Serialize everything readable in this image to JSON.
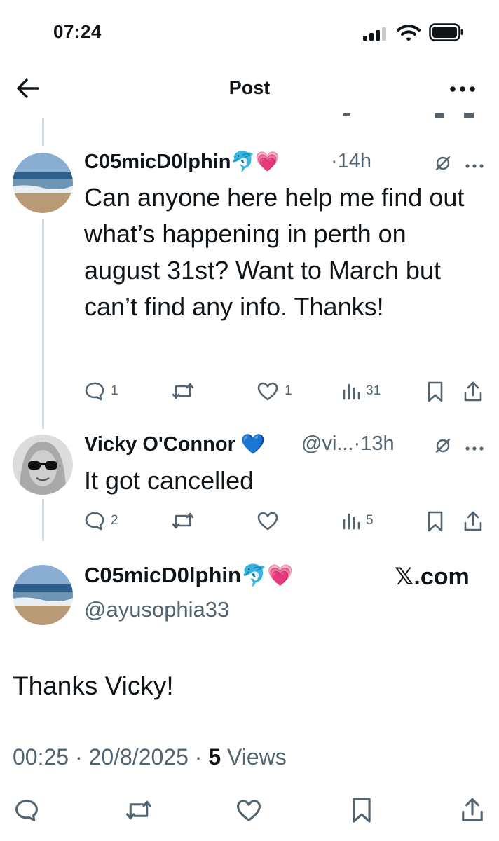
{
  "status_bar": {
    "time": "07:24"
  },
  "header": {
    "title": "Post"
  },
  "tweets": [
    {
      "name": "C05micD0lphin",
      "emojis": "🐬💗",
      "meta": "·14h",
      "text": "Can anyone here help me find out what’s happening in perth on august 31st? Want to March but can’t find any info. Thanks!",
      "replies": "1",
      "retweets": "",
      "likes": "1",
      "views": "31"
    },
    {
      "name": "Vicky O'Connor",
      "emojis": "💙",
      "meta": "@vi...·13h",
      "text": "It got cancelled",
      "replies": "2",
      "retweets": "",
      "likes": "",
      "views": "5"
    }
  ],
  "main_post": {
    "name": "C05micD0lphin",
    "emojis": "🐬💗",
    "handle": "@ayusophia33",
    "watermark": "𝕏.com",
    "text": "Thanks Vicky!",
    "time_date": "00:25 · 20/8/2025 · ",
    "views_count": "5",
    "views_label": " Views"
  },
  "colors": {
    "text": "#0f1419",
    "secondary": "#536471",
    "thread_line": "#cfd9de"
  }
}
